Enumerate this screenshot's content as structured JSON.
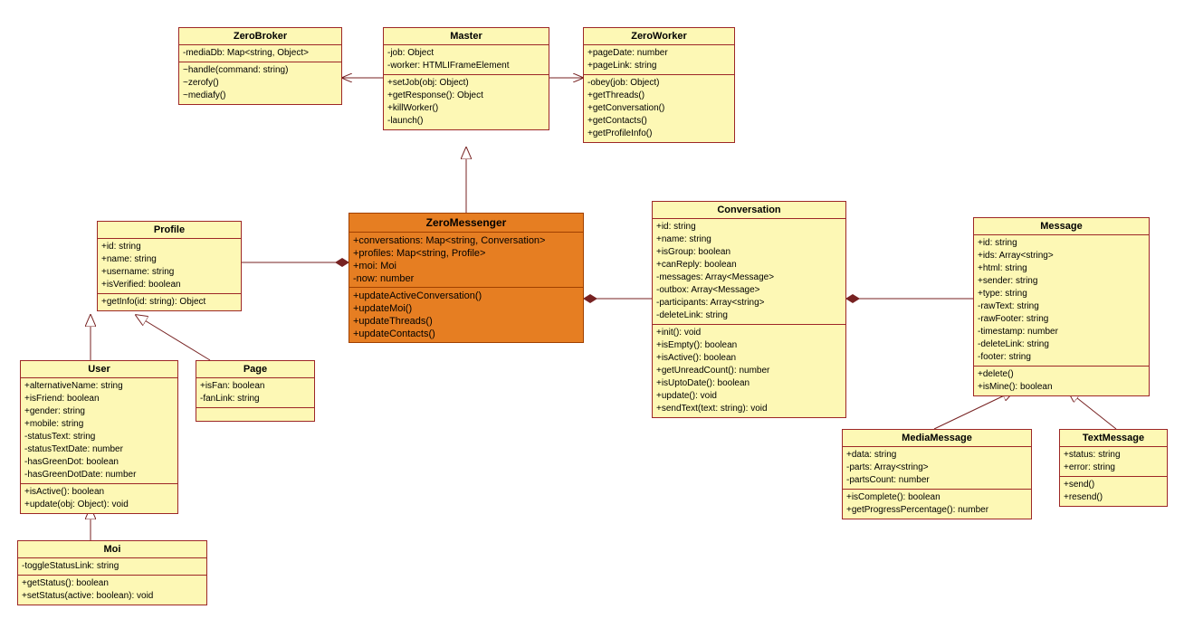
{
  "classes": {
    "ZeroBroker": {
      "name": "ZeroBroker",
      "attrs": [
        "-mediaDb: Map<string, Object>"
      ],
      "methods": [
        "~handle(command: string)",
        "~zerofy()",
        "~mediafy()"
      ]
    },
    "Master": {
      "name": "Master",
      "attrs": [
        "-job: Object",
        "-worker: HTMLIFrameElement"
      ],
      "methods": [
        "+setJob(obj: Object)",
        "+getResponse(): Object",
        "+killWorker()",
        "-launch()"
      ]
    },
    "ZeroWorker": {
      "name": "ZeroWorker",
      "attrs": [
        "+pageDate: number",
        "+pageLink: string"
      ],
      "methods": [
        "-obey(job: Object)",
        "+getThreads()",
        "+getConversation()",
        "+getContacts()",
        "+getProfileInfo()"
      ]
    },
    "Profile": {
      "name": "Profile",
      "attrs": [
        "+id: string",
        "+name: string",
        "+username: string",
        "+isVerified: boolean"
      ],
      "methods": [
        "+getInfo(id: string): Object"
      ]
    },
    "ZeroMessenger": {
      "name": "ZeroMessenger",
      "attrs": [
        "+conversations: Map<string, Conversation>",
        "+profiles: Map<string, Profile>",
        "+moi: Moi",
        "-now: number"
      ],
      "methods": [
        "+updateActiveConversation()",
        "+updateMoi()",
        "+updateThreads()",
        "+updateContacts()"
      ]
    },
    "Conversation": {
      "name": "Conversation",
      "attrs": [
        "+id: string",
        "+name: string",
        "+isGroup: boolean",
        "+canReply: boolean",
        "-messages: Array<Message>",
        "-outbox: Array<Message>",
        "-participants: Array<string>",
        "-deleteLink: string"
      ],
      "methods": [
        "+init(): void",
        "+isEmpty(): boolean",
        "+isActive(): boolean",
        "+getUnreadCount(): number",
        "+isUptoDate(): boolean",
        "+update(): void",
        "+sendText(text: string): void"
      ]
    },
    "Message": {
      "name": "Message",
      "attrs": [
        "+id: string",
        "+ids: Array<string>",
        "+html: string",
        "+sender: string",
        "+type: string",
        "-rawText: string",
        "-rawFooter: string",
        "-timestamp: number",
        "-deleteLink: string",
        "-footer: string"
      ],
      "methods": [
        "+delete()",
        "+isMine(): boolean"
      ]
    },
    "User": {
      "name": "User",
      "attrs": [
        "+alternativeName: string",
        "+isFriend: boolean",
        "+gender: string",
        "+mobile: string",
        "-statusText: string",
        "-statusTextDate: number",
        "-hasGreenDot: boolean",
        "-hasGreenDotDate: number"
      ],
      "methods": [
        "+isActive(): boolean",
        "+update(obj: Object): void"
      ]
    },
    "Page": {
      "name": "Page",
      "attrs": [
        "+isFan: boolean",
        "-fanLink: string"
      ],
      "methods": []
    },
    "Moi": {
      "name": "Moi",
      "attrs": [
        "-toggleStatusLink: string"
      ],
      "methods": [
        "+getStatus(): boolean",
        "+setStatus(active: boolean): void"
      ]
    },
    "MediaMessage": {
      "name": "MediaMessage",
      "attrs": [
        "+data: string",
        "-parts: Array<string>",
        "-partsCount: number"
      ],
      "methods": [
        "+isComplete(): boolean",
        "+getProgressPercentage(): number"
      ]
    },
    "TextMessage": {
      "name": "TextMessage",
      "attrs": [
        "+status: string",
        "+error: string"
      ],
      "methods": [
        "+send()",
        "+resend()"
      ]
    }
  },
  "chart_data": {
    "type": "uml_class_diagram",
    "classes": [
      "ZeroBroker",
      "Master",
      "ZeroWorker",
      "Profile",
      "ZeroMessenger",
      "Conversation",
      "Message",
      "User",
      "Page",
      "Moi",
      "MediaMessage",
      "TextMessage"
    ],
    "relations": [
      {
        "from": "ZeroBroker",
        "to": "Master",
        "type": "association",
        "direction": "left-arrow"
      },
      {
        "from": "Master",
        "to": "ZeroWorker",
        "type": "association",
        "direction": "right-arrow"
      },
      {
        "from": "ZeroMessenger",
        "to": "Master",
        "type": "generalization"
      },
      {
        "from": "ZeroMessenger",
        "to": "Profile",
        "type": "composition"
      },
      {
        "from": "ZeroMessenger",
        "to": "Conversation",
        "type": "composition"
      },
      {
        "from": "Conversation",
        "to": "Message",
        "type": "composition"
      },
      {
        "from": "User",
        "to": "Profile",
        "type": "generalization"
      },
      {
        "from": "Page",
        "to": "Profile",
        "type": "generalization"
      },
      {
        "from": "Moi",
        "to": "User",
        "type": "generalization"
      },
      {
        "from": "MediaMessage",
        "to": "Message",
        "type": "generalization"
      },
      {
        "from": "TextMessage",
        "to": "Message",
        "type": "generalization"
      }
    ]
  }
}
